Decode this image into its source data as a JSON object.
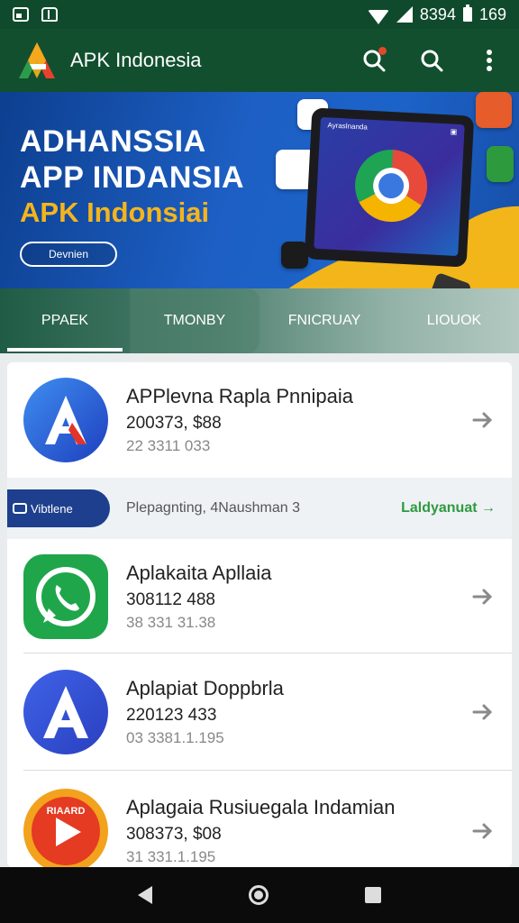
{
  "status_bar": {
    "indicator": "8394",
    "time": "169"
  },
  "app_bar": {
    "title": "APK Indonesia",
    "icons": [
      "search-notification-icon",
      "search-icon",
      "more-vert-icon"
    ]
  },
  "banner": {
    "line1": "ADHANSSIA",
    "line2": "APP INDANSIA",
    "line3": "APK Indonsiai",
    "button": "Devnien",
    "tablet_title": "Ayraslnanda",
    "accent_color": "#f4b51c"
  },
  "tabs": [
    {
      "label": "PPAEK"
    },
    {
      "label": "TMONBY"
    },
    {
      "label": "FNICRUAY"
    },
    {
      "label": "LIOUOK"
    }
  ],
  "apps": [
    {
      "name": "APPlevna Rapla Pnnipaia",
      "size": "200373, $88",
      "meta": "22 3311 033",
      "icon": "a-letter-icon"
    },
    {
      "name": "Aplakaita Apllaia",
      "size": "308112 488",
      "meta": "38 331 31.38",
      "icon": "whatsapp-icon"
    },
    {
      "name": "Aplapiat Doppbrla",
      "size": "220123 433",
      "meta": "03 3381.1.195",
      "icon": "a-letter-blue-icon"
    },
    {
      "name": "Aplagaia Rusiuegala Indamian",
      "size": "308373, $08",
      "meta": "31 331.1.195",
      "icon": "media-play-icon"
    }
  ],
  "promo": {
    "badge": "Vibtlene",
    "text": "Plepagnting, 4Naushman 3",
    "link": "Laldyanuat"
  }
}
